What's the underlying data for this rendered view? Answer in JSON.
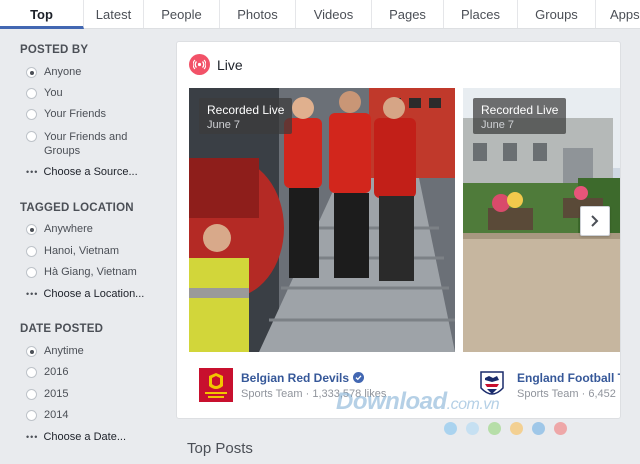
{
  "tabs": [
    "Top",
    "Latest",
    "People",
    "Photos",
    "Videos",
    "Pages",
    "Places",
    "Groups",
    "Apps"
  ],
  "filters": {
    "posted_by": {
      "heading": "POSTED BY",
      "options": [
        "Anyone",
        "You",
        "Your Friends",
        "Your Friends and Groups"
      ],
      "more": "Choose a Source..."
    },
    "tagged_location": {
      "heading": "TAGGED LOCATION",
      "options": [
        "Anywhere",
        "Hanoi, Vietnam",
        "Hà Giang, Vietnam"
      ],
      "more": "Choose a Location..."
    },
    "date_posted": {
      "heading": "DATE POSTED",
      "options": [
        "Anytime",
        "2016",
        "2015",
        "2014"
      ],
      "more": "Choose a Date..."
    }
  },
  "live": {
    "title": "Live",
    "videos": [
      {
        "label": "Recorded Live",
        "date": "June 7",
        "page": "Belgian Red Devils",
        "sub": "Sports Team · 1,333,578 likes",
        "verified": true
      },
      {
        "label": "Recorded Live",
        "date": "June 7",
        "page": "England Football Te",
        "sub": "Sports Team · 6,452"
      }
    ]
  },
  "top_posts": "Top Posts",
  "watermark": {
    "main": "Download",
    "suffix": ".com.vn"
  },
  "colors": {
    "accent": "#4267b2",
    "live": "#f25268",
    "link": "#365899"
  }
}
